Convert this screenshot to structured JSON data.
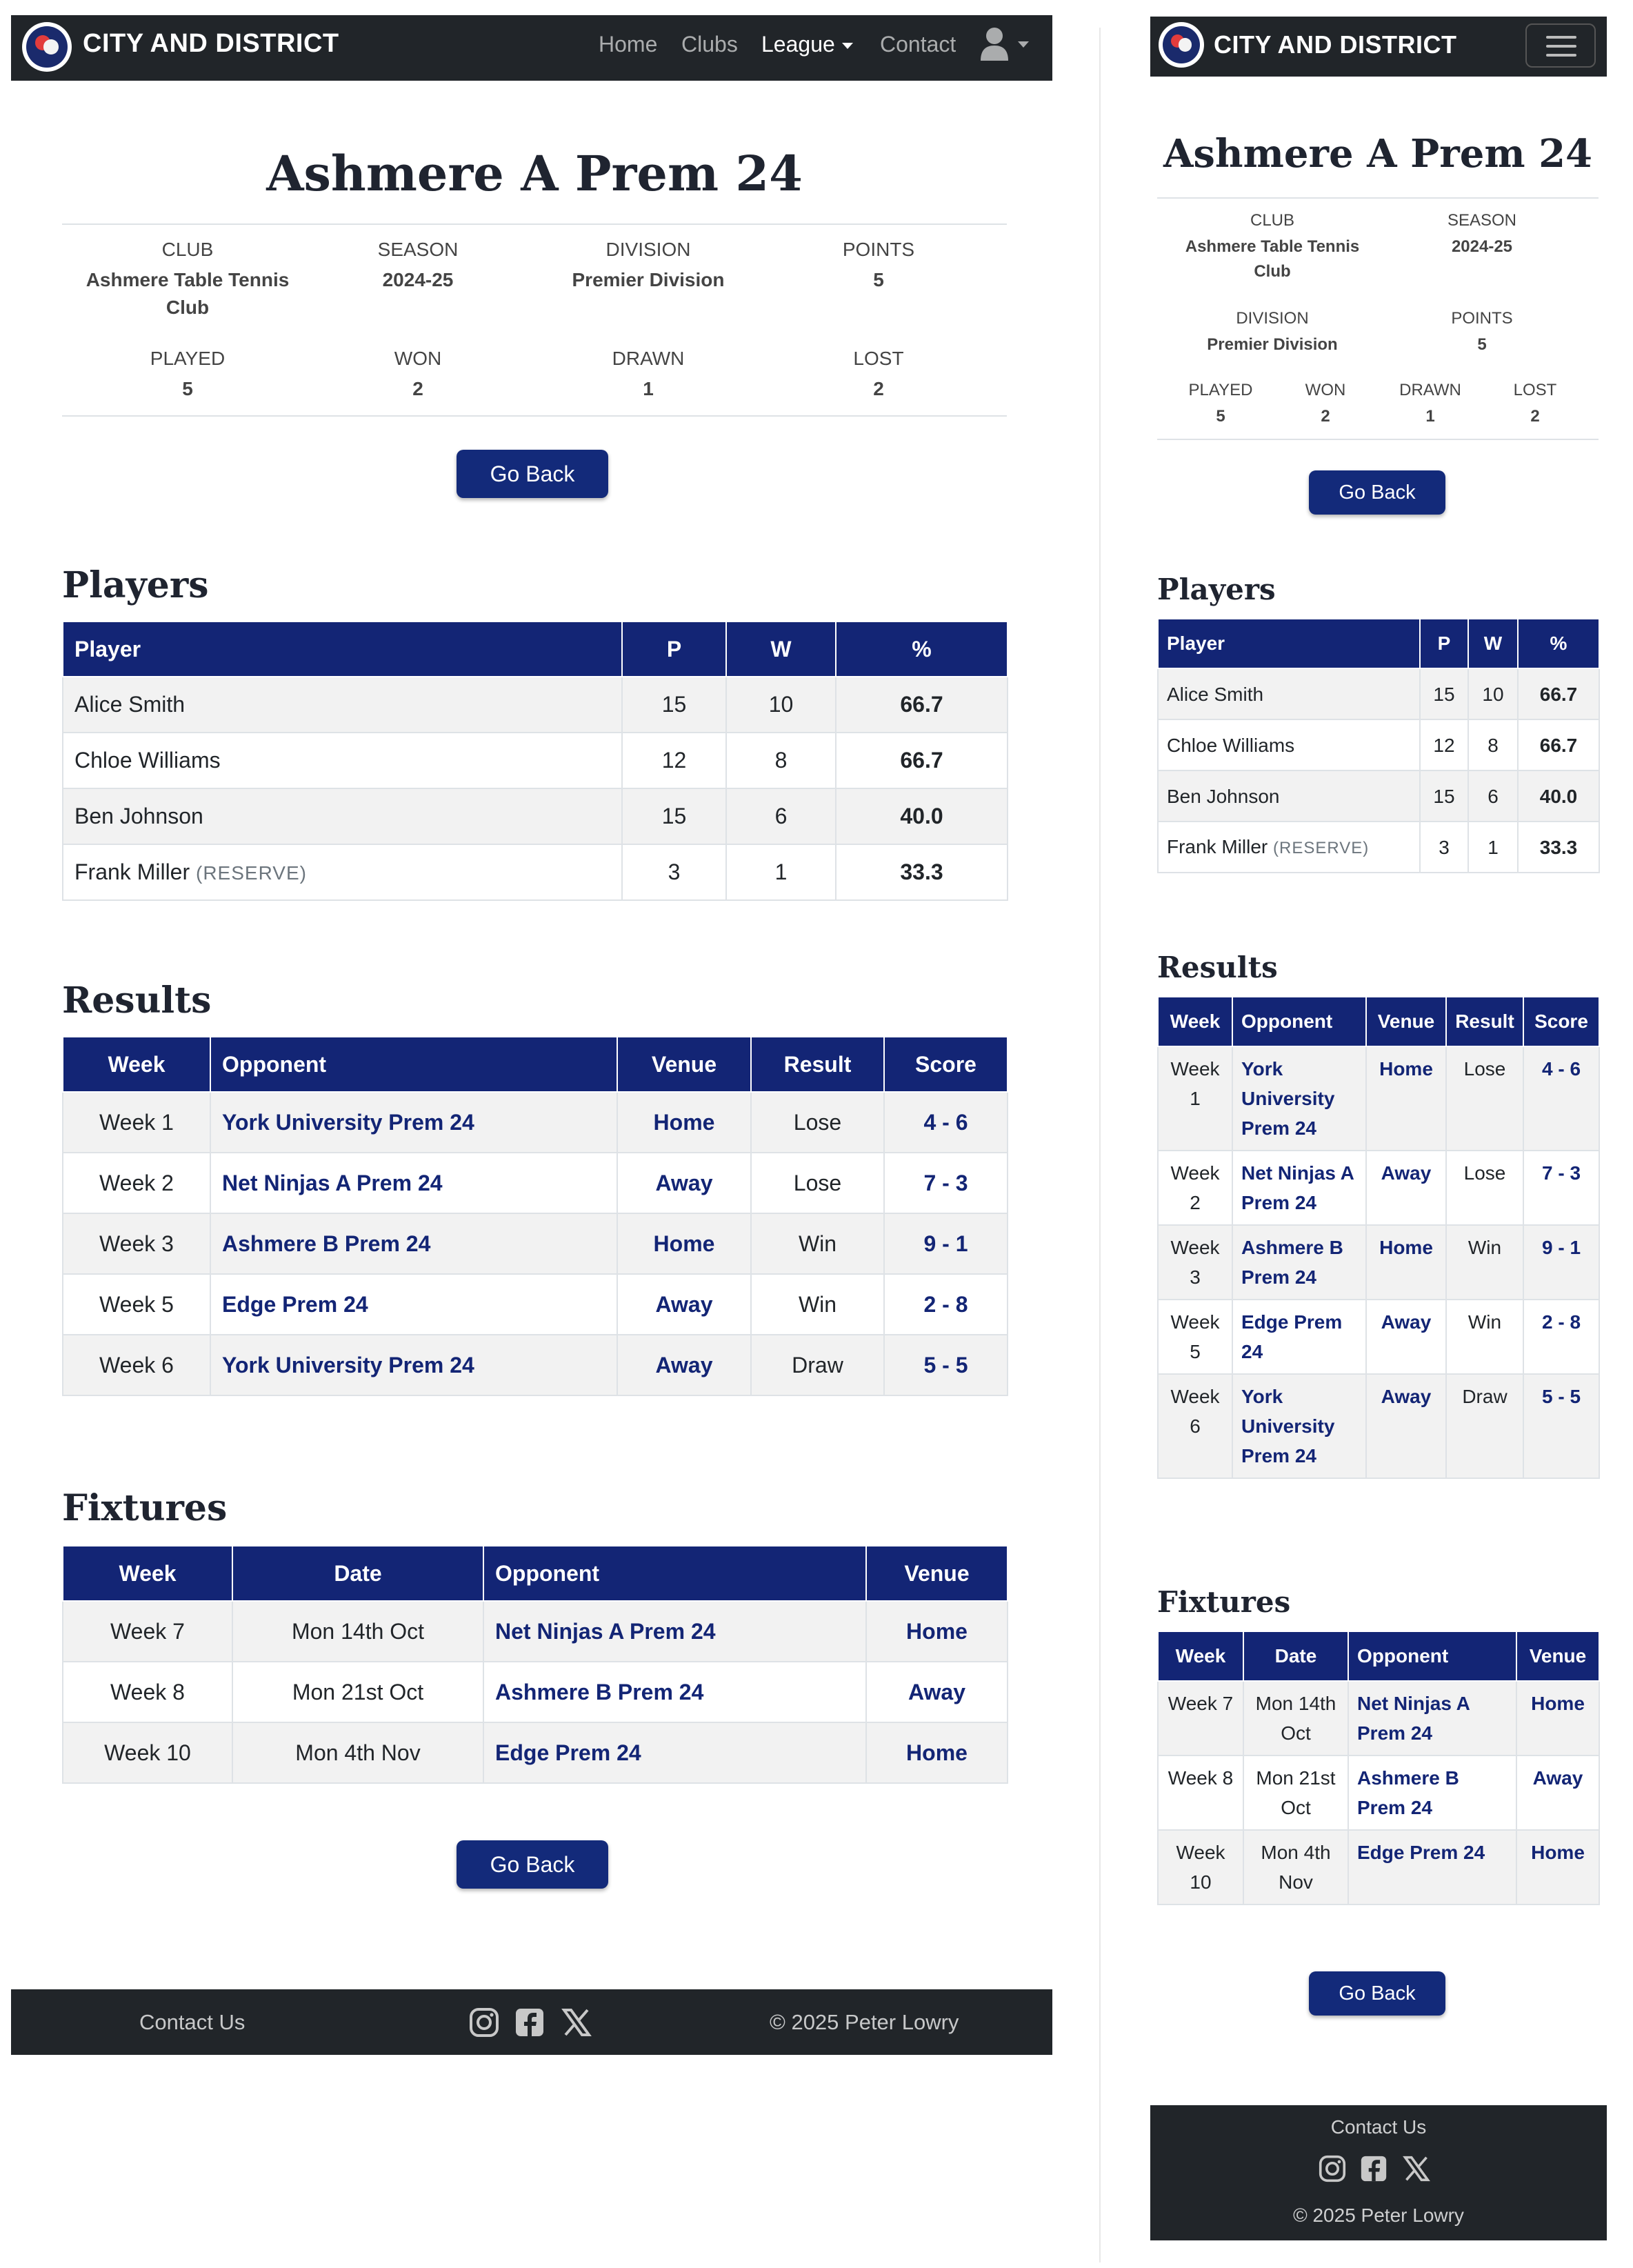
{
  "brand": {
    "name": "CITY AND DISTRICT"
  },
  "nav": {
    "home": "Home",
    "clubs": "Clubs",
    "league": "League",
    "contact": "Contact"
  },
  "team": {
    "name": "Ashmere A Prem 24",
    "stats": {
      "club_label": "CLUB",
      "club": "Ashmere Table Tennis Club",
      "season_label": "SEASON",
      "season": "2024-25",
      "division_label": "DIVISION",
      "division": "Premier Division",
      "points_label": "POINTS",
      "points": "5",
      "played_label": "PLAYED",
      "played": "5",
      "won_label": "WON",
      "won": "2",
      "drawn_label": "DRAWN",
      "drawn": "1",
      "lost_label": "LOST",
      "lost": "2"
    }
  },
  "buttons": {
    "go_back": "Go Back"
  },
  "players": {
    "title": "Players",
    "headers": [
      "Player",
      "P",
      "W",
      "%"
    ],
    "rows": [
      {
        "name": "Alice Smith",
        "reserve": "",
        "p": "15",
        "w": "10",
        "pct": "66.7"
      },
      {
        "name": "Chloe Williams",
        "reserve": "",
        "p": "12",
        "w": "8",
        "pct": "66.7"
      },
      {
        "name": "Ben Johnson",
        "reserve": "",
        "p": "15",
        "w": "6",
        "pct": "40.0"
      },
      {
        "name": "Frank Miller",
        "reserve": "(RESERVE)",
        "p": "3",
        "w": "1",
        "pct": "33.3"
      }
    ]
  },
  "results": {
    "title": "Results",
    "headers": [
      "Week",
      "Opponent",
      "Venue",
      "Result",
      "Score"
    ],
    "rows": [
      {
        "week": "Week 1",
        "opponent": "York University Prem 24",
        "venue": "Home",
        "result": "Lose",
        "score": "4 - 6"
      },
      {
        "week": "Week 2",
        "opponent": "Net Ninjas A Prem 24",
        "venue": "Away",
        "result": "Lose",
        "score": "7 - 3"
      },
      {
        "week": "Week 3",
        "opponent": "Ashmere B Prem 24",
        "venue": "Home",
        "result": "Win",
        "score": "9 - 1"
      },
      {
        "week": "Week 5",
        "opponent": "Edge Prem 24",
        "venue": "Away",
        "result": "Win",
        "score": "2 - 8"
      },
      {
        "week": "Week 6",
        "opponent": "York University Prem 24",
        "venue": "Away",
        "result": "Draw",
        "score": "5 - 5"
      }
    ]
  },
  "fixtures": {
    "title": "Fixtures",
    "headers": [
      "Week",
      "Date",
      "Opponent",
      "Venue"
    ],
    "rows": [
      {
        "week": "Week 7",
        "date": "Mon 14th Oct",
        "opponent": "Net Ninjas A Prem 24",
        "venue": "Home"
      },
      {
        "week": "Week 8",
        "date": "Mon 21st Oct",
        "opponent": "Ashmere B Prem 24",
        "venue": "Away"
      },
      {
        "week": "Week 10",
        "date": "Mon 4th Nov",
        "opponent": "Edge Prem 24",
        "venue": "Home"
      }
    ]
  },
  "footer": {
    "contact": "Contact Us",
    "copyright": "© 2025 Peter Lowry",
    "icons": [
      "instagram-icon",
      "facebook-icon",
      "x-icon"
    ]
  },
  "colors": {
    "nav_bg": "#212529",
    "primary": "#132575",
    "link": "#132575"
  }
}
